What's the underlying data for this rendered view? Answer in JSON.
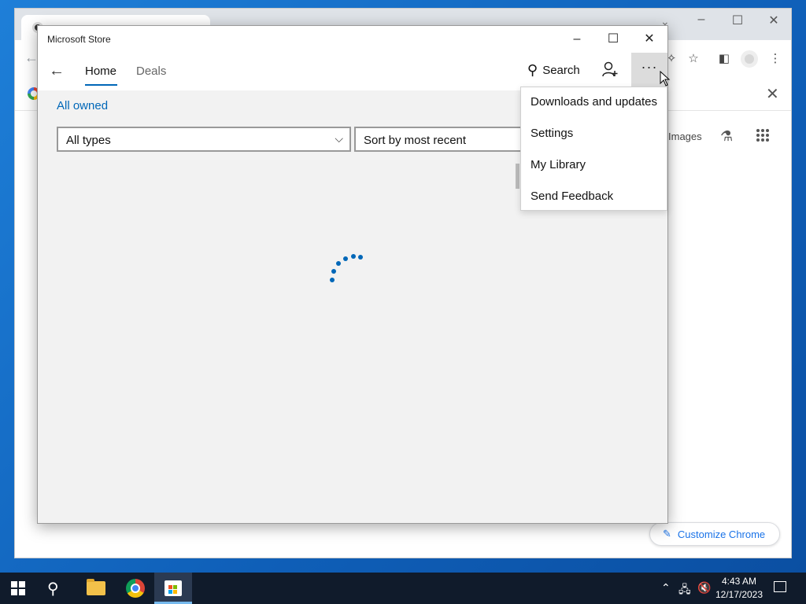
{
  "store": {
    "window_title": "Microsoft Store",
    "nav": {
      "back_icon": "arrow-left-icon",
      "home": "Home",
      "deals": "Deals",
      "search": "Search"
    },
    "section_link": "All owned",
    "filters": {
      "type_selected": "All types",
      "sort_selected": "Sort by most recent"
    },
    "menu": {
      "items": [
        "Downloads and updates",
        "Settings",
        "My Library",
        "Send Feedback"
      ]
    },
    "accent_color": "#0067b8"
  },
  "chrome": {
    "images_label": "Images",
    "customize_label": "Customize Chrome"
  },
  "taskbar": {
    "time": "4:43 AM",
    "date": "12/17/2023"
  }
}
